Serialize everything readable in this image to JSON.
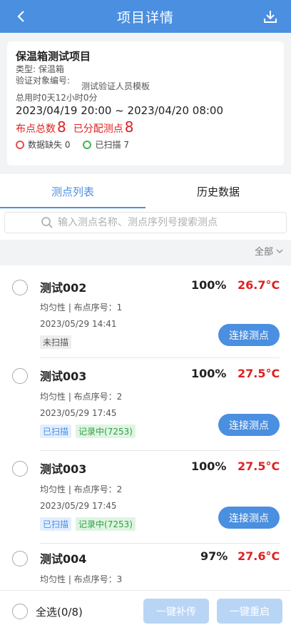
{
  "header": {
    "title": "项目详情",
    "back_icon": "chevron-left-icon",
    "download_icon": "download-icon"
  },
  "project": {
    "title": "保温箱测试项目",
    "type_label": "类型:",
    "type_value": "保温箱",
    "verify_label": "验证对象编号:",
    "verify_value": "测试验证人员模板",
    "duration_label": "总用时",
    "duration_value": "0天12小时0分",
    "date_range": "2023/04/19 20:00 ~ 2023/04/20 08:00",
    "total_label": "布点总数",
    "total_value": "8",
    "assigned_label": "已分配测点",
    "assigned_value": "8",
    "missing_label": "数据缺失",
    "missing_value": "0",
    "scanned_label": "已扫描",
    "scanned_value": "7"
  },
  "tabs": [
    {
      "label": "测点列表",
      "active": true
    },
    {
      "label": "历史数据",
      "active": false
    }
  ],
  "search": {
    "placeholder": "输入测点名称、测点序列号搜索测点"
  },
  "filter": {
    "label": "全部"
  },
  "items": [
    {
      "name": "测试002",
      "percent": "100%",
      "temp": "26.7°C",
      "meta": "均匀性 | 布点序号：1",
      "time": "2023/05/29 14:41",
      "tags": [
        "未扫描"
      ],
      "button": "连接测点"
    },
    {
      "name": "测试003",
      "percent": "100%",
      "temp": "27.5°C",
      "meta": "均匀性 | 布点序号：2",
      "time": "2023/05/29 17:45",
      "tags": [
        "已扫描",
        "记录中(7253)"
      ],
      "button": "连接测点"
    },
    {
      "name": "测试003",
      "percent": "100%",
      "temp": "27.5°C",
      "meta": "均匀性 | 布点序号：2",
      "time": "2023/05/29 17:45",
      "tags": [
        "已扫描",
        "记录中(7253)"
      ],
      "button": "连接测点"
    },
    {
      "name": "测试004",
      "percent": "97%",
      "temp": "27.6°C",
      "meta": "均匀性 | 布点序号：3"
    }
  ],
  "footer": {
    "select_all": "全选(0/8)",
    "resend": "一键补传",
    "restart": "一键重启"
  },
  "colors": {
    "primary": "#4a8fe0",
    "alert": "#e02020",
    "recording": "#2e9e46"
  }
}
